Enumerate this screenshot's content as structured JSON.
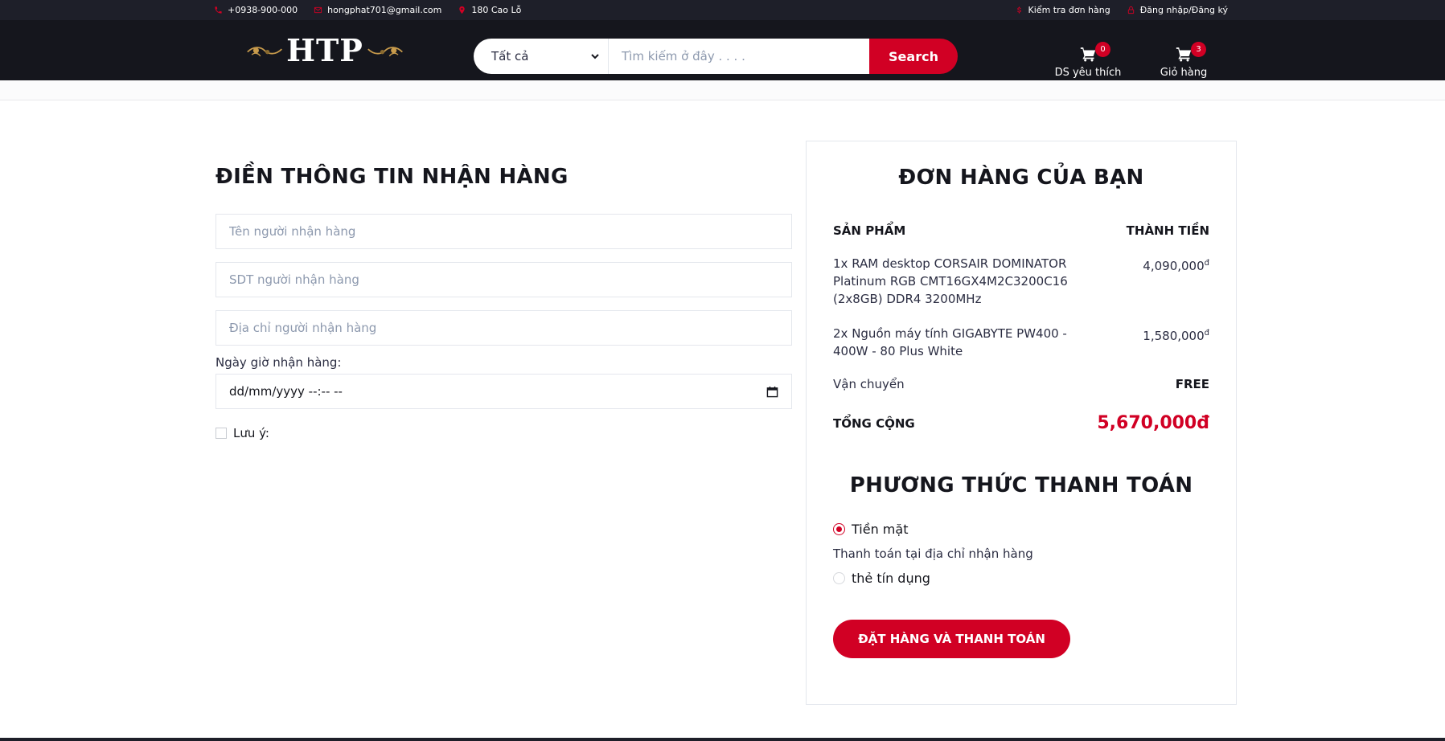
{
  "topbar": {
    "phone": "+0938-900-000",
    "email": "hongphat701@gmail.com",
    "address": "180 Cao Lỗ",
    "check_order": "Kiểm tra đơn hàng",
    "login": "Đăng nhập/Đăng ký"
  },
  "header": {
    "logo_text": "HTP",
    "search": {
      "category": "Tất cả",
      "placeholder": "Tìm kiếm ở đây . . . .",
      "button": "Search"
    },
    "wishlist": {
      "label": "DS yêu thích",
      "count": "0"
    },
    "cart": {
      "label": "Giỏ hàng",
      "count": "3"
    }
  },
  "shipping_form": {
    "title": "ĐIỀN THÔNG TIN NHẬN HÀNG",
    "name_placeholder": "Tên người nhận hàng",
    "phone_placeholder": "SDT người nhận hàng",
    "address_placeholder": "Địa chỉ người nhận hàng",
    "date_label": "Ngày giờ nhận hàng:",
    "date_value": "dd/mm/yyyy  --:-- --",
    "note_label": "Lưu ý:"
  },
  "order": {
    "title": "ĐƠN HÀNG CỦA BẠN",
    "col_product": "SẢN PHẨM",
    "col_total": "THÀNH TIỀN",
    "items": [
      {
        "name": "1x RAM desktop CORSAIR DOMINATOR Platinum RGB CMT16GX4M2C3200C16 (2x8GB) DDR4 3200MHz",
        "price": "4,090,000",
        "currency": "đ"
      },
      {
        "name": "2x Nguồn máy tính GIGABYTE PW400 - 400W - 80 Plus White",
        "price": "1,580,000",
        "currency": "đ"
      }
    ],
    "shipping_label": "Vận chuyển",
    "shipping_value": "FREE",
    "total_label": "TỔNG CỘNG",
    "total_value": "5,670,000đ"
  },
  "payment": {
    "title": "PHƯƠNG THỨC THANH TOÁN",
    "option_cash": "Tiền mặt",
    "cash_desc": "Thanh toán tại địa chỉ nhận hàng",
    "option_card": "thẻ tín dụng",
    "submit": "ĐẶT HÀNG VÀ THANH TOÁN"
  },
  "colors": {
    "accent": "#d10024",
    "header_bg": "#15161d",
    "topbar_bg": "#1e1f29"
  }
}
